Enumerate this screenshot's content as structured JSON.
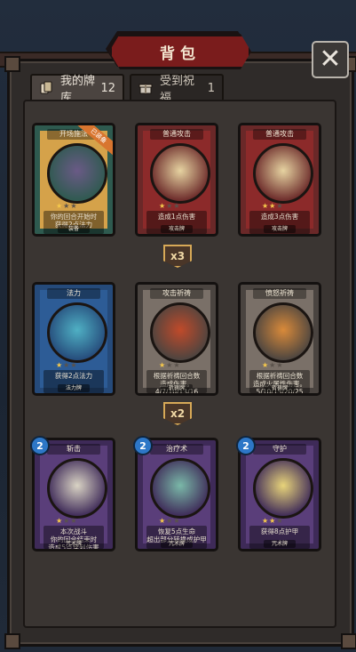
{
  "header": {
    "title": "背包",
    "close_symbol": "✕"
  },
  "tabs": [
    {
      "label": "我的牌库",
      "count": "12",
      "icon": "cards-icon"
    },
    {
      "label": "受到祝福",
      "count": "1",
      "icon": "gift-icon"
    }
  ],
  "cards": [
    {
      "name": "开场施法",
      "stars_on": "★",
      "stars_off": "★★",
      "desc": "你的回合开始时\n获得2点法力",
      "footer": "装备",
      "badge": "已装备",
      "frame": "#d5a24a",
      "inner": "#2e5a4f",
      "art": "#6a5a86"
    },
    {
      "name": "普通攻击",
      "stars_on": "★",
      "stars_off": "★★",
      "desc": "造成1点伤害",
      "footer": "攻击牌",
      "badge": "",
      "frame": "#8c2a2a",
      "inner": "#6a2828",
      "art": "#e6d3a1"
    },
    {
      "name": "普通攻击",
      "stars_on": "★★",
      "stars_off": "★",
      "desc": "造成3点伤害",
      "footer": "攻击牌",
      "badge": "",
      "frame": "#8c2a2a",
      "inner": "#6a2828",
      "art": "#e6d3a1"
    },
    {
      "name": "法力",
      "stars_on": "★",
      "stars_off": "★★",
      "desc": "获得2点法力",
      "footer": "法力牌",
      "badge": "",
      "frame": "#2d5c96",
      "inner": "#254a7a",
      "art": "#4fb0c4"
    },
    {
      "name": "攻击祈祷",
      "stars_on": "★",
      "stars_off": "★★",
      "desc": "根据祈祷回合数\n造成伤害。\n4/7/10/13/16",
      "footer": "祈祷牌",
      "badge": "",
      "frame": "#7a7068",
      "inner": "#4a4440",
      "art": "#c04a2a"
    },
    {
      "name": "愤怒祈祷",
      "stars_on": "★",
      "stars_off": "★★",
      "desc": "根据祈祷回合数\n造成火属性伤害。\n5/10/15/20/25",
      "footer": "祈祷牌",
      "badge": "",
      "frame": "#7a7068",
      "inner": "#4a4440",
      "art": "#d98a3a"
    },
    {
      "name": "斩击",
      "stars_on": "★",
      "stars_off": "★★",
      "desc": "本次战斗\n你的回合结束时\n造成5点穿刺伤害",
      "footer": "咒术牌",
      "badge": "",
      "frame": "#5a3e7a",
      "inner": "#3e2a58",
      "art": "#d9d3c4",
      "cost": "2"
    },
    {
      "name": "治疗术",
      "stars_on": "★",
      "stars_off": "★★",
      "desc": "恢复5点生命\n超出部分转换成护甲",
      "footer": "咒术牌",
      "badge": "",
      "frame": "#5a3e7a",
      "inner": "#3e2a58",
      "art": "#7ab8a8",
      "cost": "2"
    },
    {
      "name": "守护",
      "stars_on": "★★",
      "stars_off": "★",
      "desc": "获得8点护甲",
      "footer": "咒术牌",
      "badge": "",
      "frame": "#5a3e7a",
      "inner": "#3e2a58",
      "art": "#e8d47a",
      "cost": "2"
    }
  ],
  "multipliers": [
    {
      "label": "x3"
    },
    {
      "label": "x2"
    }
  ]
}
